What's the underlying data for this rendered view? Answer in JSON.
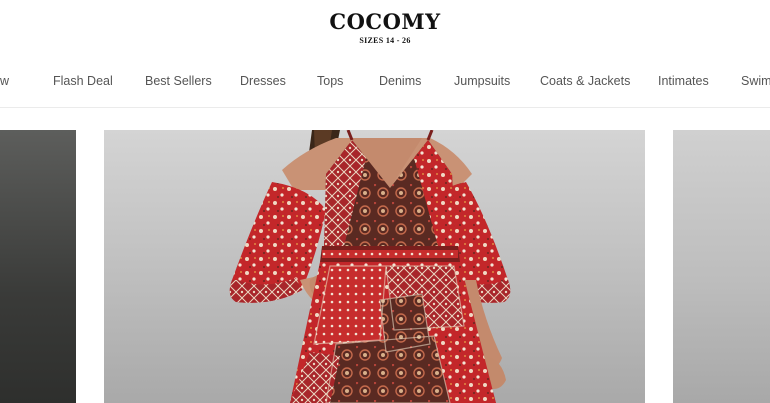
{
  "brand": {
    "name": "COCOMY",
    "tagline": "SIZES 14 - 26"
  },
  "nav": {
    "items": [
      {
        "label": "New"
      },
      {
        "label": "Flash Deal"
      },
      {
        "label": "Best Sellers"
      },
      {
        "label": "Dresses"
      },
      {
        "label": "Tops"
      },
      {
        "label": "Denims"
      },
      {
        "label": "Jumpsuits"
      },
      {
        "label": "Coats & Jackets"
      },
      {
        "label": "Intimates"
      },
      {
        "label": "Swimwear"
      }
    ]
  },
  "carousel": {
    "main_slide": {
      "image_subject": "model-in-red-paisley-maxi-dress"
    },
    "colors": {
      "dress_red": "#c3272a",
      "dress_dark": "#5a2a22",
      "skin": "#c99275"
    }
  }
}
